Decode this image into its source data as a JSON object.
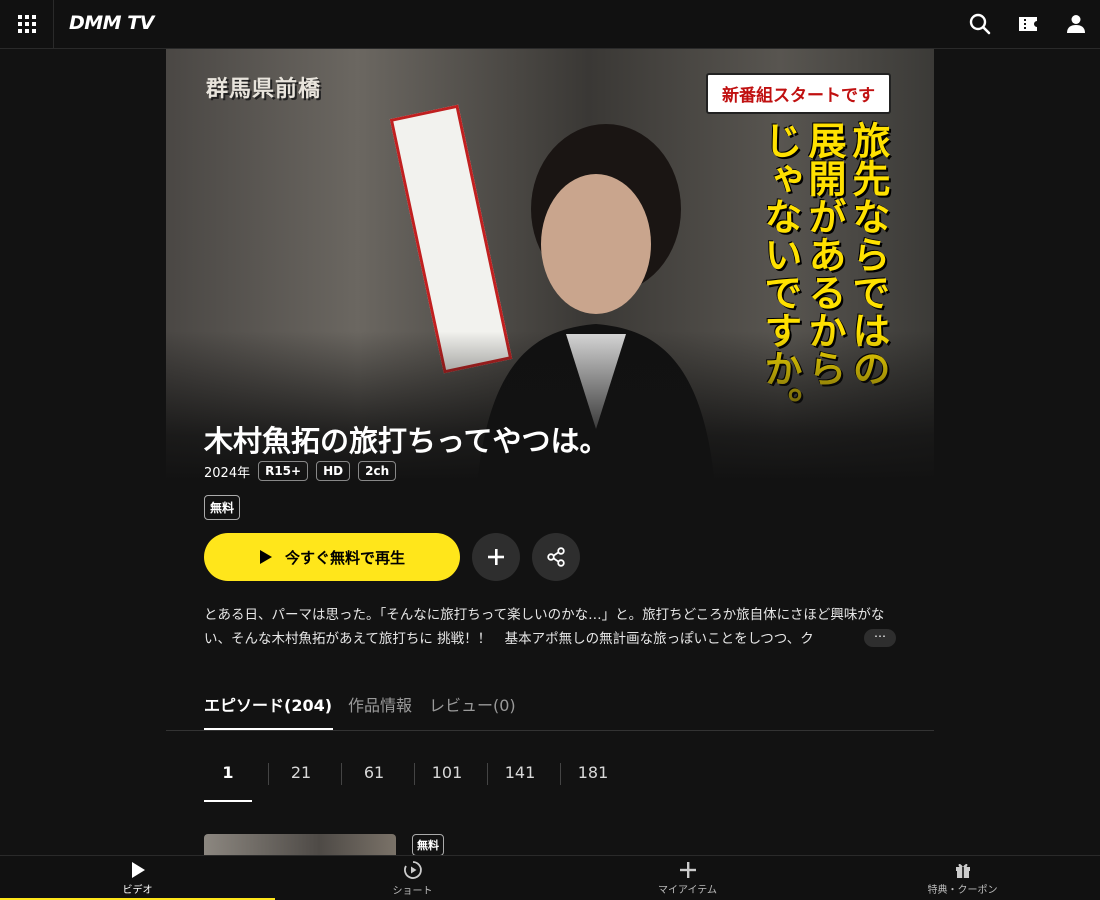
{
  "header": {
    "logo": "DMM TV"
  },
  "hero": {
    "location_text": "群馬県前橋",
    "badge_text": "新番組スタートです",
    "vertical_lines": [
      "旅先ならではの",
      "展開があるから",
      "じゃないですか。"
    ]
  },
  "show": {
    "title": "木村魚拓の旅打ちってやつは。",
    "year": "2024年",
    "chips": [
      "R15+",
      "HD",
      "2ch"
    ],
    "price_badge": "無料",
    "play_label": "今すぐ無料で再生",
    "description": "とある日、パーマは思った。「そんなに旅打ちって楽しいのかな…」と。旅打ちどころか旅自体にさほど興味がない、そんな木村魚拓があえて旅打ちに 挑戦！！　基本アポ無しの無計画な旅っぽいことをしつつ、ク",
    "more_label": "⋯"
  },
  "tabs": [
    {
      "label": "エピソード(204)",
      "active": true
    },
    {
      "label": "作品情報",
      "active": false
    },
    {
      "label": "レビュー(0)",
      "active": false
    }
  ],
  "ranges": [
    "1",
    "21",
    "61",
    "101",
    "141",
    "181"
  ],
  "episode": {
    "free_badge": "無料"
  },
  "bottom_nav": [
    {
      "label": "ビデオ",
      "icon": "play-icon",
      "active": true
    },
    {
      "label": "ショート",
      "icon": "short-play-icon",
      "active": false
    },
    {
      "label": "マイアイテム",
      "icon": "plus-icon",
      "active": false
    },
    {
      "label": "特典・クーポン",
      "icon": "gift-icon",
      "active": false
    }
  ],
  "colors": {
    "accent": "#ffe61b",
    "background": "#121212"
  }
}
